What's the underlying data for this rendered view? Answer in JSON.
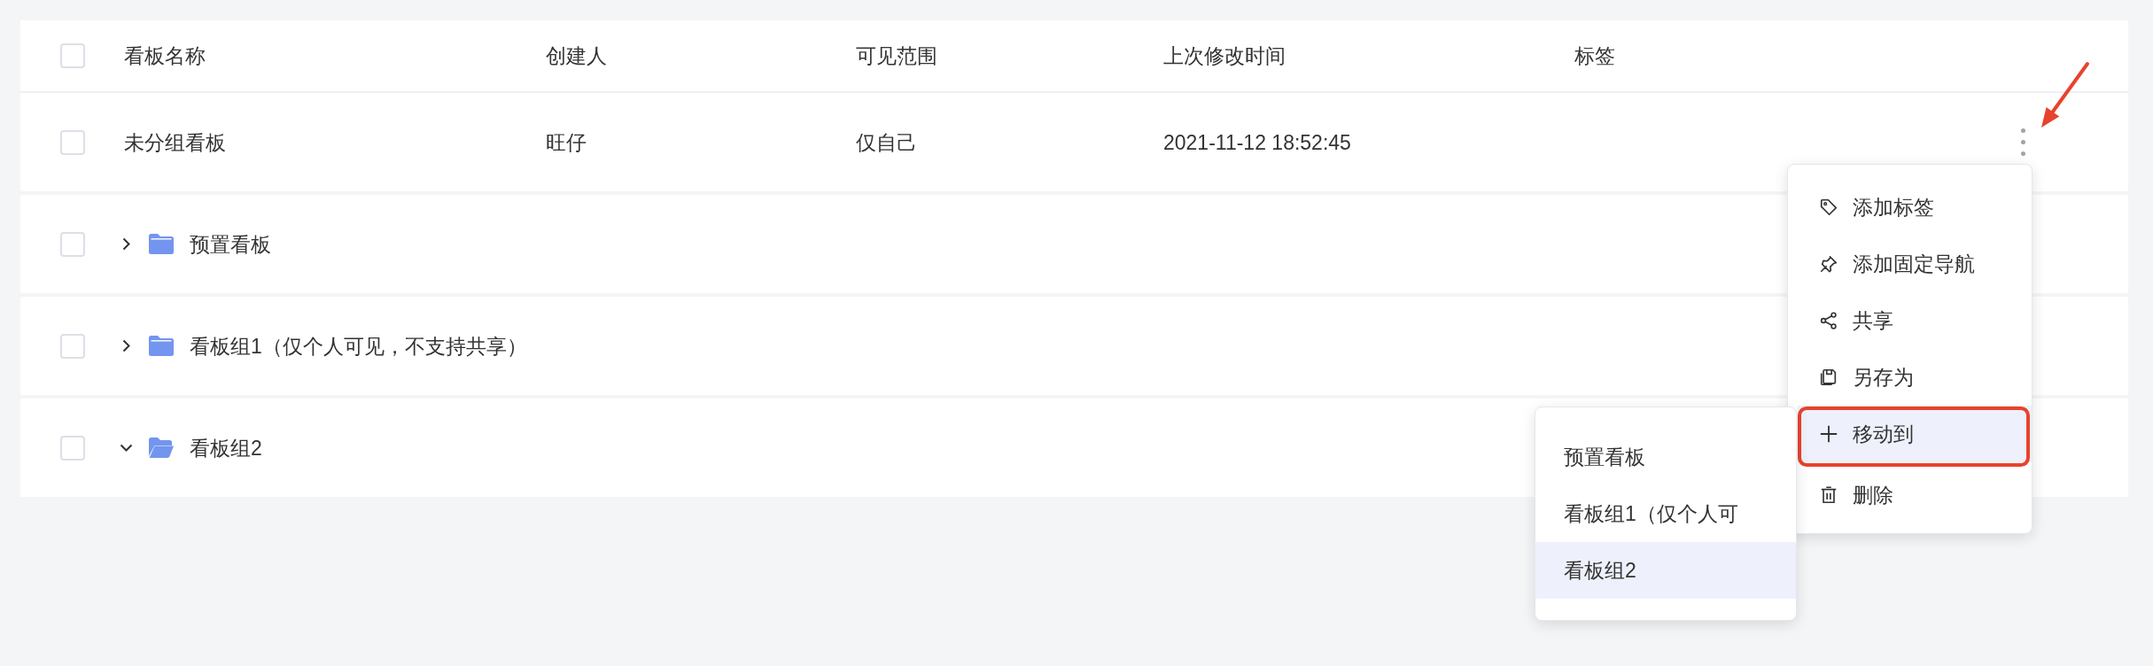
{
  "table": {
    "header_checkbox": {
      "checked": false
    },
    "columns": [
      "看板名称",
      "创建人",
      "可见范围",
      "上次修改时间",
      "标签"
    ],
    "rows": [
      {
        "kind": "board",
        "checked": false,
        "name": "未分组看板",
        "creator": "旺仔",
        "visibility": "仅自己",
        "modified": "2021-11-12 18:52:45",
        "annotated": true
      },
      {
        "kind": "group",
        "checked": false,
        "expanded": false,
        "name": "预置看板"
      },
      {
        "kind": "group",
        "checked": false,
        "expanded": false,
        "name": "看板组1（仅个人可见，不支持共享）"
      },
      {
        "kind": "group",
        "checked": false,
        "expanded": true,
        "name": "看板组2"
      }
    ]
  },
  "context_menu": {
    "items": [
      {
        "kind": "tag",
        "label": "添加标签",
        "selected": false,
        "annotated": false
      },
      {
        "kind": "pin",
        "label": "添加固定导航",
        "selected": false,
        "annotated": false
      },
      {
        "kind": "share",
        "label": "共享",
        "selected": false,
        "annotated": false
      },
      {
        "kind": "save",
        "label": "另存为",
        "selected": false,
        "annotated": false
      },
      {
        "kind": "move",
        "label": "移动到",
        "selected": true,
        "annotated": true
      },
      {
        "kind": "delete",
        "label": "删除",
        "selected": false,
        "annotated": false
      }
    ]
  },
  "submenu": {
    "items": [
      {
        "label": "预置看板",
        "selected": false
      },
      {
        "label": "看板组1（仅个人可",
        "selected": false
      },
      {
        "label": "看板组2",
        "selected": true
      }
    ]
  }
}
